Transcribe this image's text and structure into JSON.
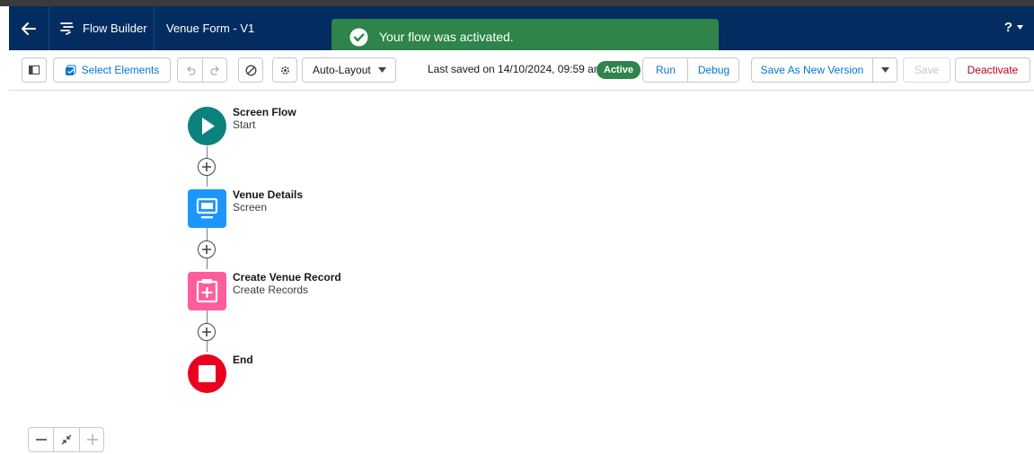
{
  "header": {
    "app_name": "Flow Builder",
    "flow_title": "Venue Form - V1",
    "help_label": "?"
  },
  "toast": {
    "message": "Your flow was activated.",
    "color": "#2e844a"
  },
  "toolbar": {
    "select_elements_label": "Select Elements",
    "layout_mode": "Auto-Layout",
    "last_saved": "Last saved on 14/10/2024, 09:59 am",
    "status_badge": "Active",
    "run_label": "Run",
    "debug_label": "Debug",
    "save_as_new_version_label": "Save As New Version",
    "save_label": "Save",
    "deactivate_label": "Deactivate"
  },
  "flow": {
    "nodes": [
      {
        "title": "Screen Flow",
        "subtitle": "Start",
        "icon": "play-icon",
        "color": "#0b827c"
      },
      {
        "title": "Venue Details",
        "subtitle": "Screen",
        "icon": "screen-icon",
        "color": "#1b96ff"
      },
      {
        "title": "Create Venue Record",
        "subtitle": "Create Records",
        "icon": "create-records-icon",
        "color": "#ff5d9e"
      },
      {
        "title": "End",
        "subtitle": "",
        "icon": "stop-icon",
        "color": "#ea001e"
      }
    ]
  },
  "colors": {
    "header_bg": "#032d60",
    "brand_blue": "#0176d3",
    "deactivate_red": "#ba0517"
  }
}
